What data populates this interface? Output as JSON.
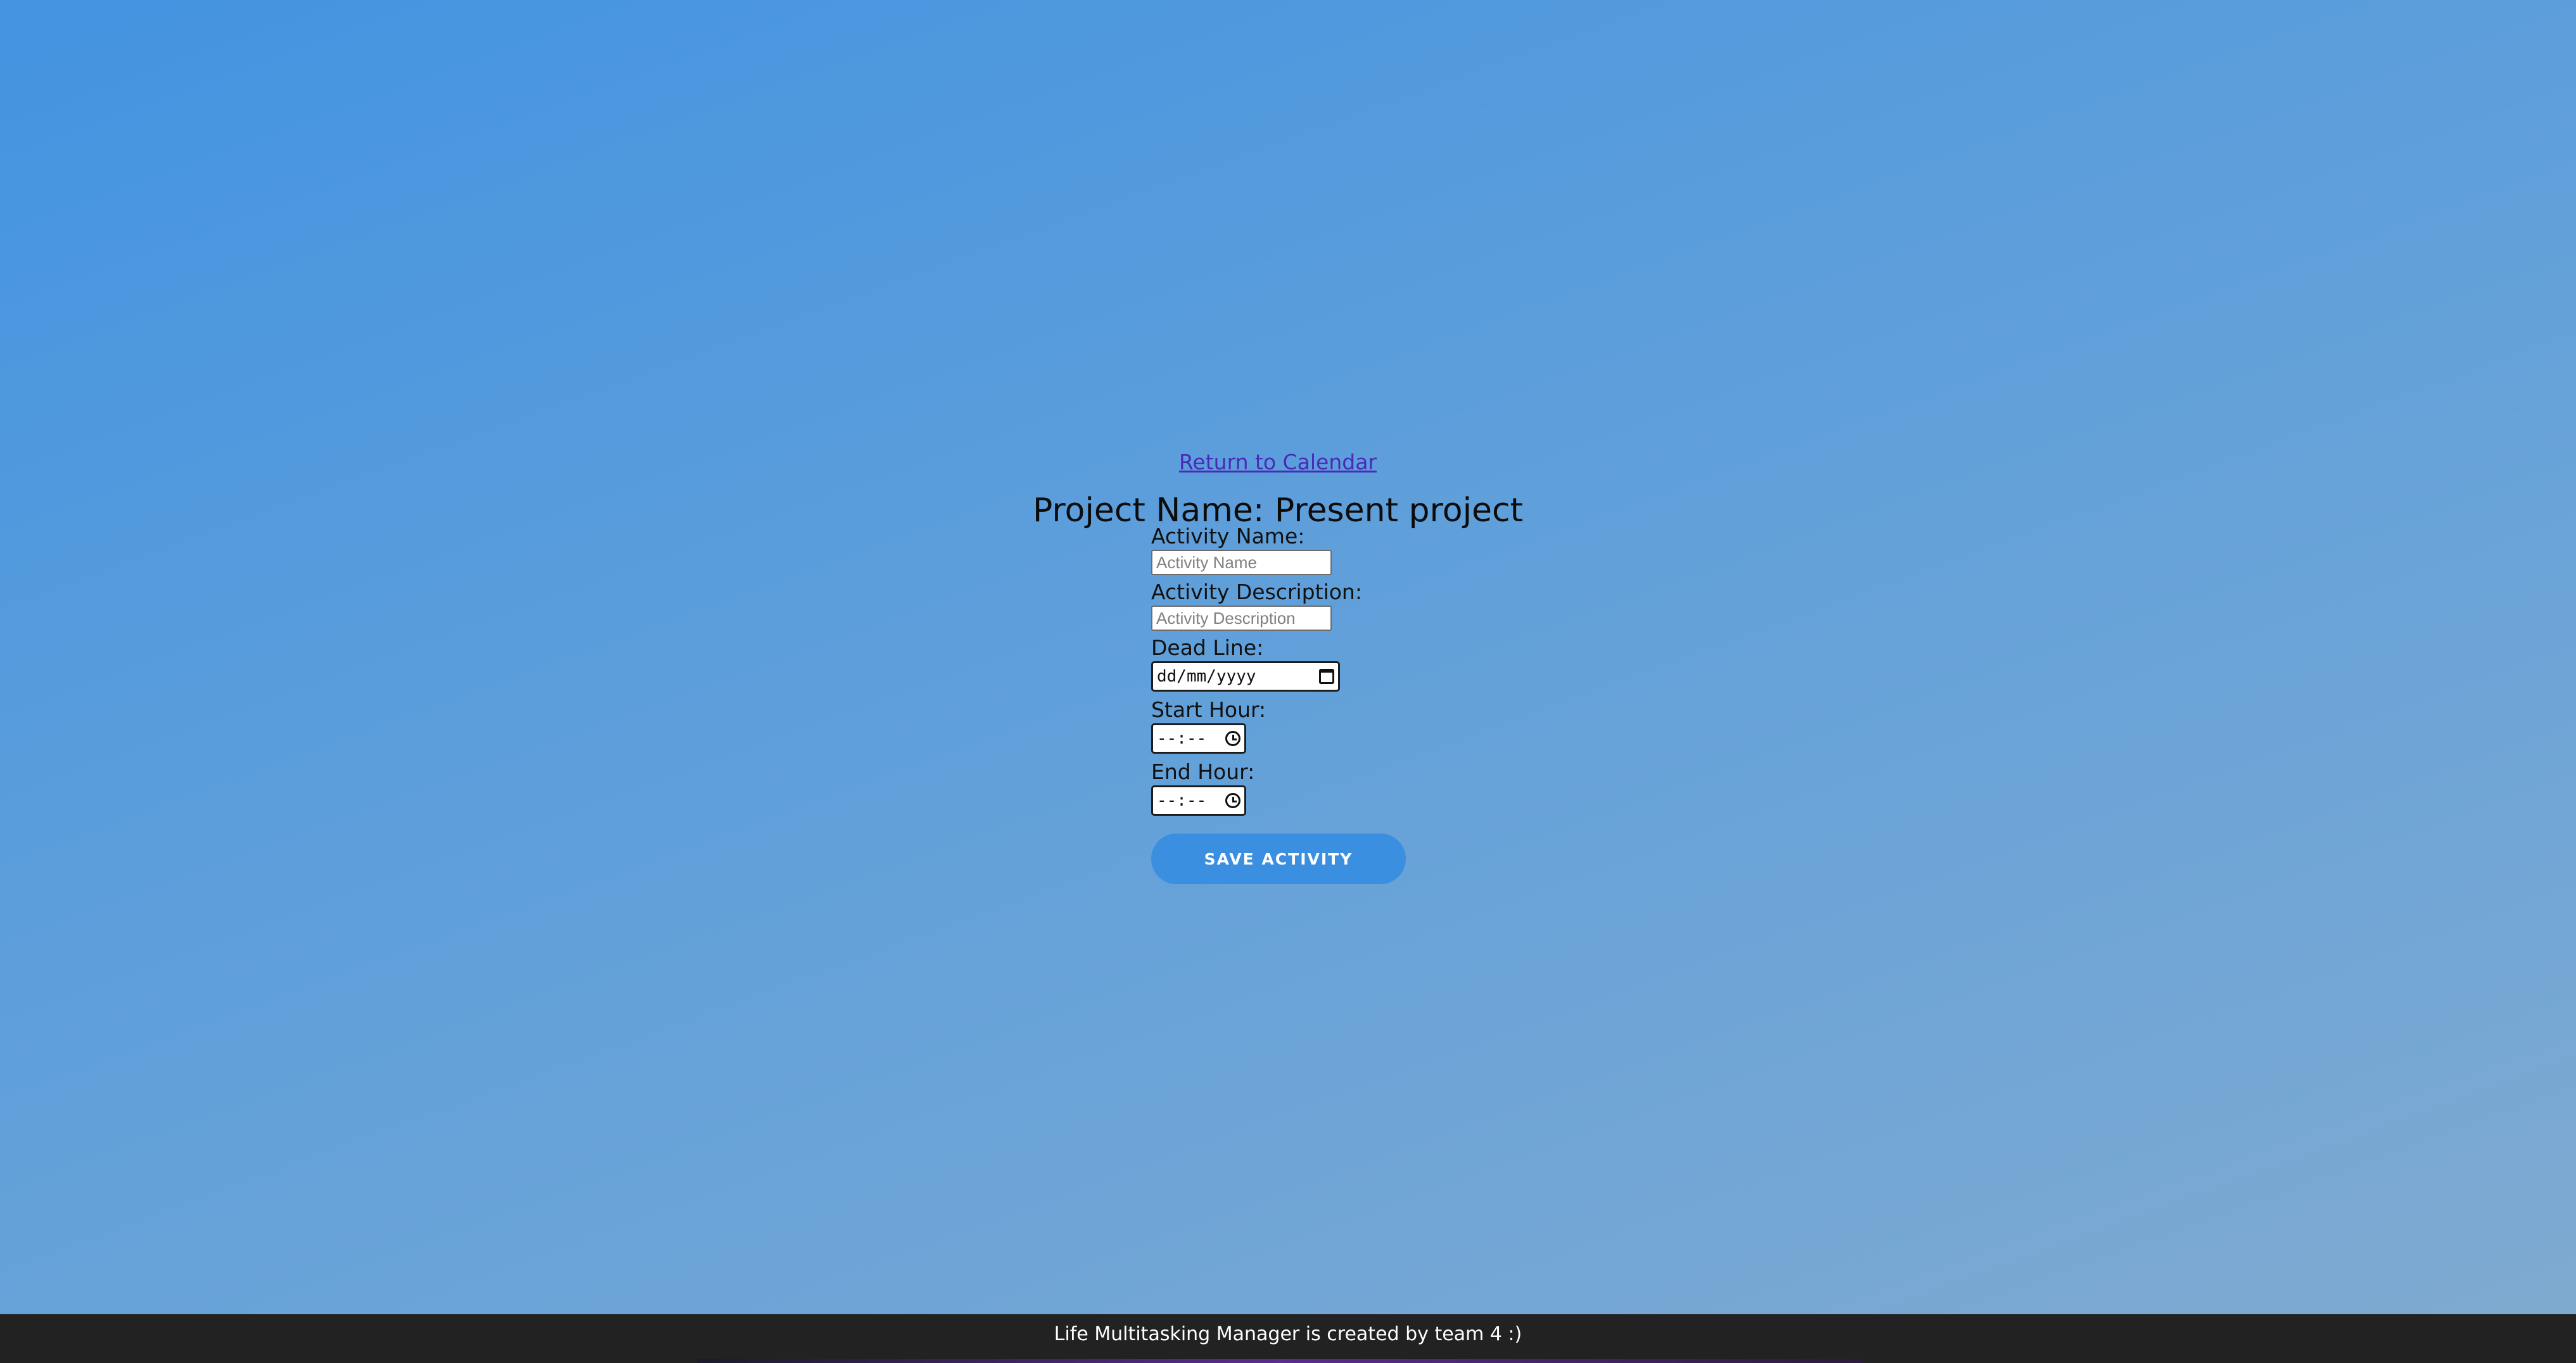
{
  "nav": {
    "return_link": "Return to Calendar"
  },
  "project": {
    "title": "Project Name: Present project"
  },
  "form": {
    "activity_name_label": "Activity Name:",
    "activity_name_placeholder": "Activity Name",
    "activity_name_value": "",
    "activity_description_label": "Activity Description:",
    "activity_description_placeholder": "Activity Description",
    "activity_description_value": "",
    "deadline_label": "Dead Line:",
    "deadline_value": "dd/mm/yyyy",
    "deadline_icon": "calendar-icon",
    "start_hour_label": "Start Hour:",
    "start_hour_value": "--:--",
    "end_hour_label": "End Hour:",
    "end_hour_value": "--:--",
    "time_icon": "clock-icon",
    "save_button": "Save Activity"
  },
  "footer": {
    "text": "Life Multitasking Manager is created by team 4 :)"
  },
  "colors": {
    "background_top": "#4393e1",
    "background_bottom": "#80aacf",
    "link": "#4a2ab8",
    "button": "#3a8fe0",
    "footer": "#222222"
  }
}
